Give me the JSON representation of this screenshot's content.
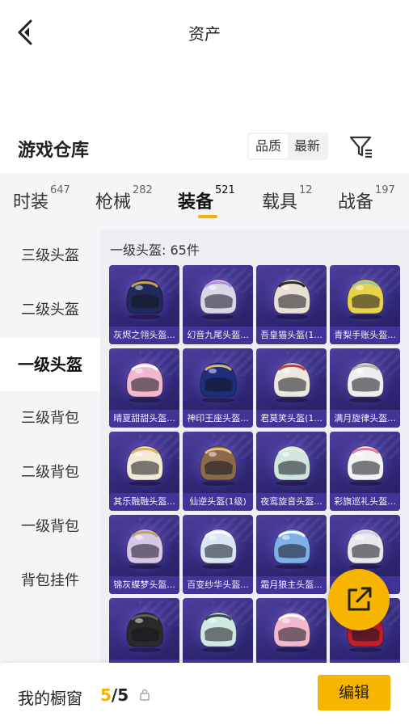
{
  "header": {
    "title": "资产"
  },
  "section": {
    "title": "游戏仓库",
    "sort_options": [
      "品质",
      "最新"
    ],
    "sort_selected": "品质"
  },
  "tabs": [
    {
      "label": "时装",
      "count": "647"
    },
    {
      "label": "枪械",
      "count": "282"
    },
    {
      "label": "装备",
      "count": "521",
      "active": true
    },
    {
      "label": "载具",
      "count": "12"
    },
    {
      "label": "战备",
      "count": "197"
    }
  ],
  "sidebar": {
    "items": [
      {
        "label": "三级头盔"
      },
      {
        "label": "二级头盔"
      },
      {
        "label": "一级头盔",
        "active": true
      },
      {
        "label": "三级背包"
      },
      {
        "label": "二级背包"
      },
      {
        "label": "一级背包"
      },
      {
        "label": "背包挂件"
      }
    ]
  },
  "content": {
    "count_label": "一级头盔: 65件",
    "items": [
      {
        "name": "灰烬之翎头盔...",
        "color": "#1f2a5a",
        "accent": "#c9a24a"
      },
      {
        "name": "幻音九尾头盔...",
        "color": "#d9d6e8",
        "accent": "#b58ce0"
      },
      {
        "name": "吾皇猫头盔(1...",
        "color": "#e7e0d3",
        "accent": "#2a2a2a"
      },
      {
        "name": "青梨手账头盔...",
        "color": "#e8d24c",
        "accent": "#9fc4a6"
      },
      {
        "name": "晴夏甜甜头盔...",
        "color": "#f2b8cf",
        "accent": "#ffffff"
      },
      {
        "name": "神印王座头盔...",
        "color": "#1d2f7a",
        "accent": "#d8b46a"
      },
      {
        "name": "君莫笑头盔(1...",
        "color": "#ece8e0",
        "accent": "#c04040"
      },
      {
        "name": "满月旋律头盔...",
        "color": "#eeeeee",
        "accent": "#b0b0b0"
      },
      {
        "name": "其乐融融头盔...",
        "color": "#f3ead6",
        "accent": "#d8b060"
      },
      {
        "name": "仙逆头盔(1级)",
        "color": "#8a6a4a",
        "accent": "#e0c080"
      },
      {
        "name": "夜鸾旋音头盔...",
        "color": "#cfe6dc",
        "accent": "#e8e8e8"
      },
      {
        "name": "彩旗巡礼头盔...",
        "color": "#f2f2f2",
        "accent": "#e07aa0"
      },
      {
        "name": "锦灰蝶梦头盔...",
        "color": "#d6c7e8",
        "accent": "#c0a060"
      },
      {
        "name": "百变纱华头盔...",
        "color": "#d8e6f6",
        "accent": "#ffffff"
      },
      {
        "name": "霜月狼主头盔...",
        "color": "#7fb0e8",
        "accent": "#ffffff"
      },
      {
        "name": "",
        "color": "#e8e8ee",
        "accent": "#cfcfe0"
      },
      {
        "name": "",
        "color": "#2a2a2a",
        "accent": "#5a5a5a"
      },
      {
        "name": "",
        "color": "#cfe8e0",
        "accent": "#2e4a48"
      },
      {
        "name": "",
        "color": "#f2b8cc",
        "accent": "#ffffff"
      },
      {
        "name": "",
        "color": "#c0202a",
        "accent": "#e04040"
      }
    ]
  },
  "bottom_bar": {
    "label": "我的橱窗",
    "current": "5",
    "separator": "/",
    "total": "5",
    "edit_label": "编辑"
  },
  "colors": {
    "accent": "#f7b500",
    "card_bg": "#2f2876",
    "page_bg": "#f4f5f7"
  }
}
